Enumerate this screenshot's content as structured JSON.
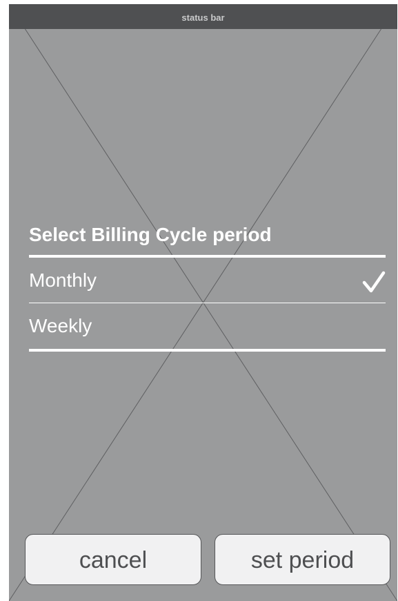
{
  "status_bar": {
    "label": "status bar"
  },
  "dialog": {
    "title": "Select Billing Cycle period",
    "options": [
      {
        "label": "Monthly",
        "selected": true,
        "indicator_icon": "checkmark-icon"
      },
      {
        "label": "Weekly",
        "selected": false
      }
    ]
  },
  "actions": {
    "cancel_label": "cancel",
    "confirm_label": "set period"
  },
  "colors": {
    "screen_background": "#9a9b9c",
    "status_bar_background": "#4f5052",
    "text_on_dark": "#ffffff",
    "button_background": "#f1f1f2",
    "button_text": "#4e4f51"
  }
}
